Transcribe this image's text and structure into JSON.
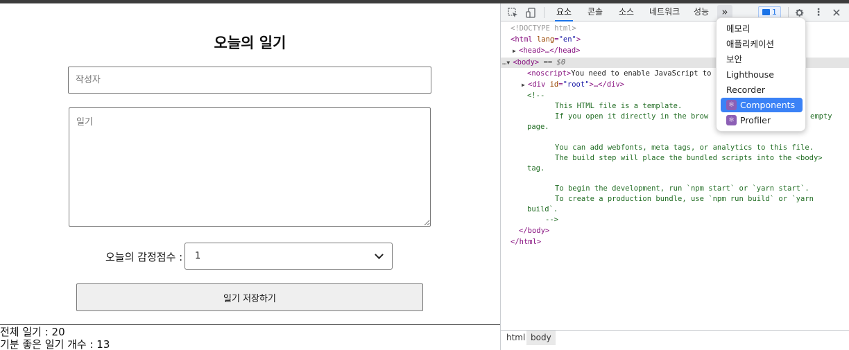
{
  "app": {
    "title": "오늘의 일기",
    "author_placeholder": "작성자",
    "content_placeholder": "일기",
    "emotion_label": "오늘의 감정점수 :",
    "emotion_selected": "1",
    "save_label": "일기 저장하기",
    "total_label": "전체 일기 : 20",
    "good_label": "기분 좋은 일기 개수 : 13"
  },
  "devtools": {
    "tabs": [
      "요소",
      "콘솔",
      "소스",
      "네트워크",
      "성능"
    ],
    "more_tabs": "»",
    "issues_count": "1",
    "dom": {
      "doctype": "<!DOCTYPE html>",
      "html_open_tag": "html",
      "html_attr": "lang",
      "html_attr_value": "\"en\"",
      "head": "<head>…</head>",
      "body_tag": "<body>",
      "body_eq": "== $0",
      "noscript": "You need to enable JavaScript to",
      "noscript_end": "script>",
      "div_root_attr": "id",
      "div_root_value": "\"root\"",
      "div_root_rest": ">…</div>",
      "comment_lines": [
        "<!--",
        "  This HTML file is a template.",
        "  If you open it directly in the brow",
        "empty",
        "page.",
        "  You can add webfonts, meta tags, or analytics to this file.",
        "  The build step will place the bundled scripts into the <body>",
        "tag.",
        "  To begin the development, run `npm start` or `yarn start`.",
        "  To create a production bundle, use `npm run build` or `yarn",
        "build`.",
        "-->"
      ],
      "body_close": "</body>",
      "html_close": "</html>"
    },
    "breadcrumbs": [
      "html",
      "body"
    ],
    "menu": [
      {
        "label": "메모리",
        "icon": ""
      },
      {
        "label": "애플리케이션",
        "icon": ""
      },
      {
        "label": "보안",
        "icon": ""
      },
      {
        "label": "Lighthouse",
        "icon": ""
      },
      {
        "label": "Recorder",
        "icon": ""
      },
      {
        "label": "Components",
        "icon": "react-icon"
      },
      {
        "label": "Profiler",
        "icon": "react-icon"
      }
    ]
  }
}
